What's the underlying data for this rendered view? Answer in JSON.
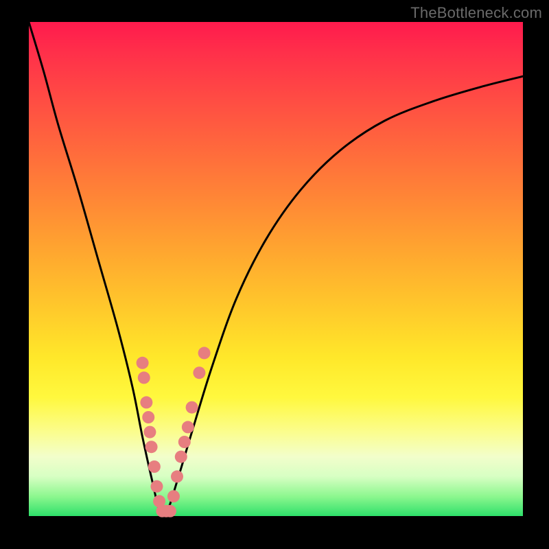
{
  "watermark": "TheBottleneck.com",
  "colors": {
    "gradient_top": "#ff1a4d",
    "gradient_mid": "#ffe82a",
    "gradient_bottom": "#2ee06a",
    "frame": "#000000",
    "curve": "#000000",
    "dots": "#e77e80",
    "watermark_text": "#6a6a6a"
  },
  "chart_data": {
    "type": "line",
    "title": "",
    "xlabel": "",
    "ylabel": "",
    "xlim": [
      0,
      100
    ],
    "ylim": [
      0,
      100
    ],
    "grid": false,
    "legend": false,
    "annotations": [
      "TheBottleneck.com"
    ],
    "series": [
      {
        "name": "bottleneck-curve",
        "x": [
          0,
          3,
          6,
          10,
          14,
          18,
          21,
          23,
          25,
          26.5,
          28,
          30,
          33,
          37,
          42,
          48,
          55,
          63,
          72,
          82,
          92,
          100
        ],
        "y": [
          100,
          90,
          79,
          66,
          52,
          38,
          26,
          16,
          7,
          1,
          1,
          7,
          17,
          30,
          44,
          56,
          66,
          74,
          80,
          84,
          87,
          89
        ]
      }
    ],
    "points": [
      {
        "name": "cluster-left",
        "x": 23.0,
        "y": 31
      },
      {
        "name": "cluster-left",
        "x": 23.3,
        "y": 28
      },
      {
        "name": "cluster-left",
        "x": 23.8,
        "y": 23
      },
      {
        "name": "cluster-left",
        "x": 24.2,
        "y": 20
      },
      {
        "name": "cluster-left",
        "x": 24.5,
        "y": 17
      },
      {
        "name": "cluster-left",
        "x": 24.8,
        "y": 14
      },
      {
        "name": "cluster-left",
        "x": 25.4,
        "y": 10
      },
      {
        "name": "cluster-left",
        "x": 25.9,
        "y": 6
      },
      {
        "name": "cluster-left",
        "x": 26.4,
        "y": 3
      },
      {
        "name": "cluster-bottom",
        "x": 27.0,
        "y": 1
      },
      {
        "name": "cluster-bottom",
        "x": 27.8,
        "y": 1
      },
      {
        "name": "cluster-bottom",
        "x": 28.6,
        "y": 1
      },
      {
        "name": "cluster-right",
        "x": 29.3,
        "y": 4
      },
      {
        "name": "cluster-right",
        "x": 30.0,
        "y": 8
      },
      {
        "name": "cluster-right",
        "x": 30.8,
        "y": 12
      },
      {
        "name": "cluster-right",
        "x": 31.5,
        "y": 15
      },
      {
        "name": "cluster-right",
        "x": 32.2,
        "y": 18
      },
      {
        "name": "cluster-right",
        "x": 33.0,
        "y": 22
      },
      {
        "name": "cluster-right",
        "x": 34.5,
        "y": 29
      },
      {
        "name": "cluster-right",
        "x": 35.5,
        "y": 33
      }
    ],
    "point_radius": 9
  }
}
